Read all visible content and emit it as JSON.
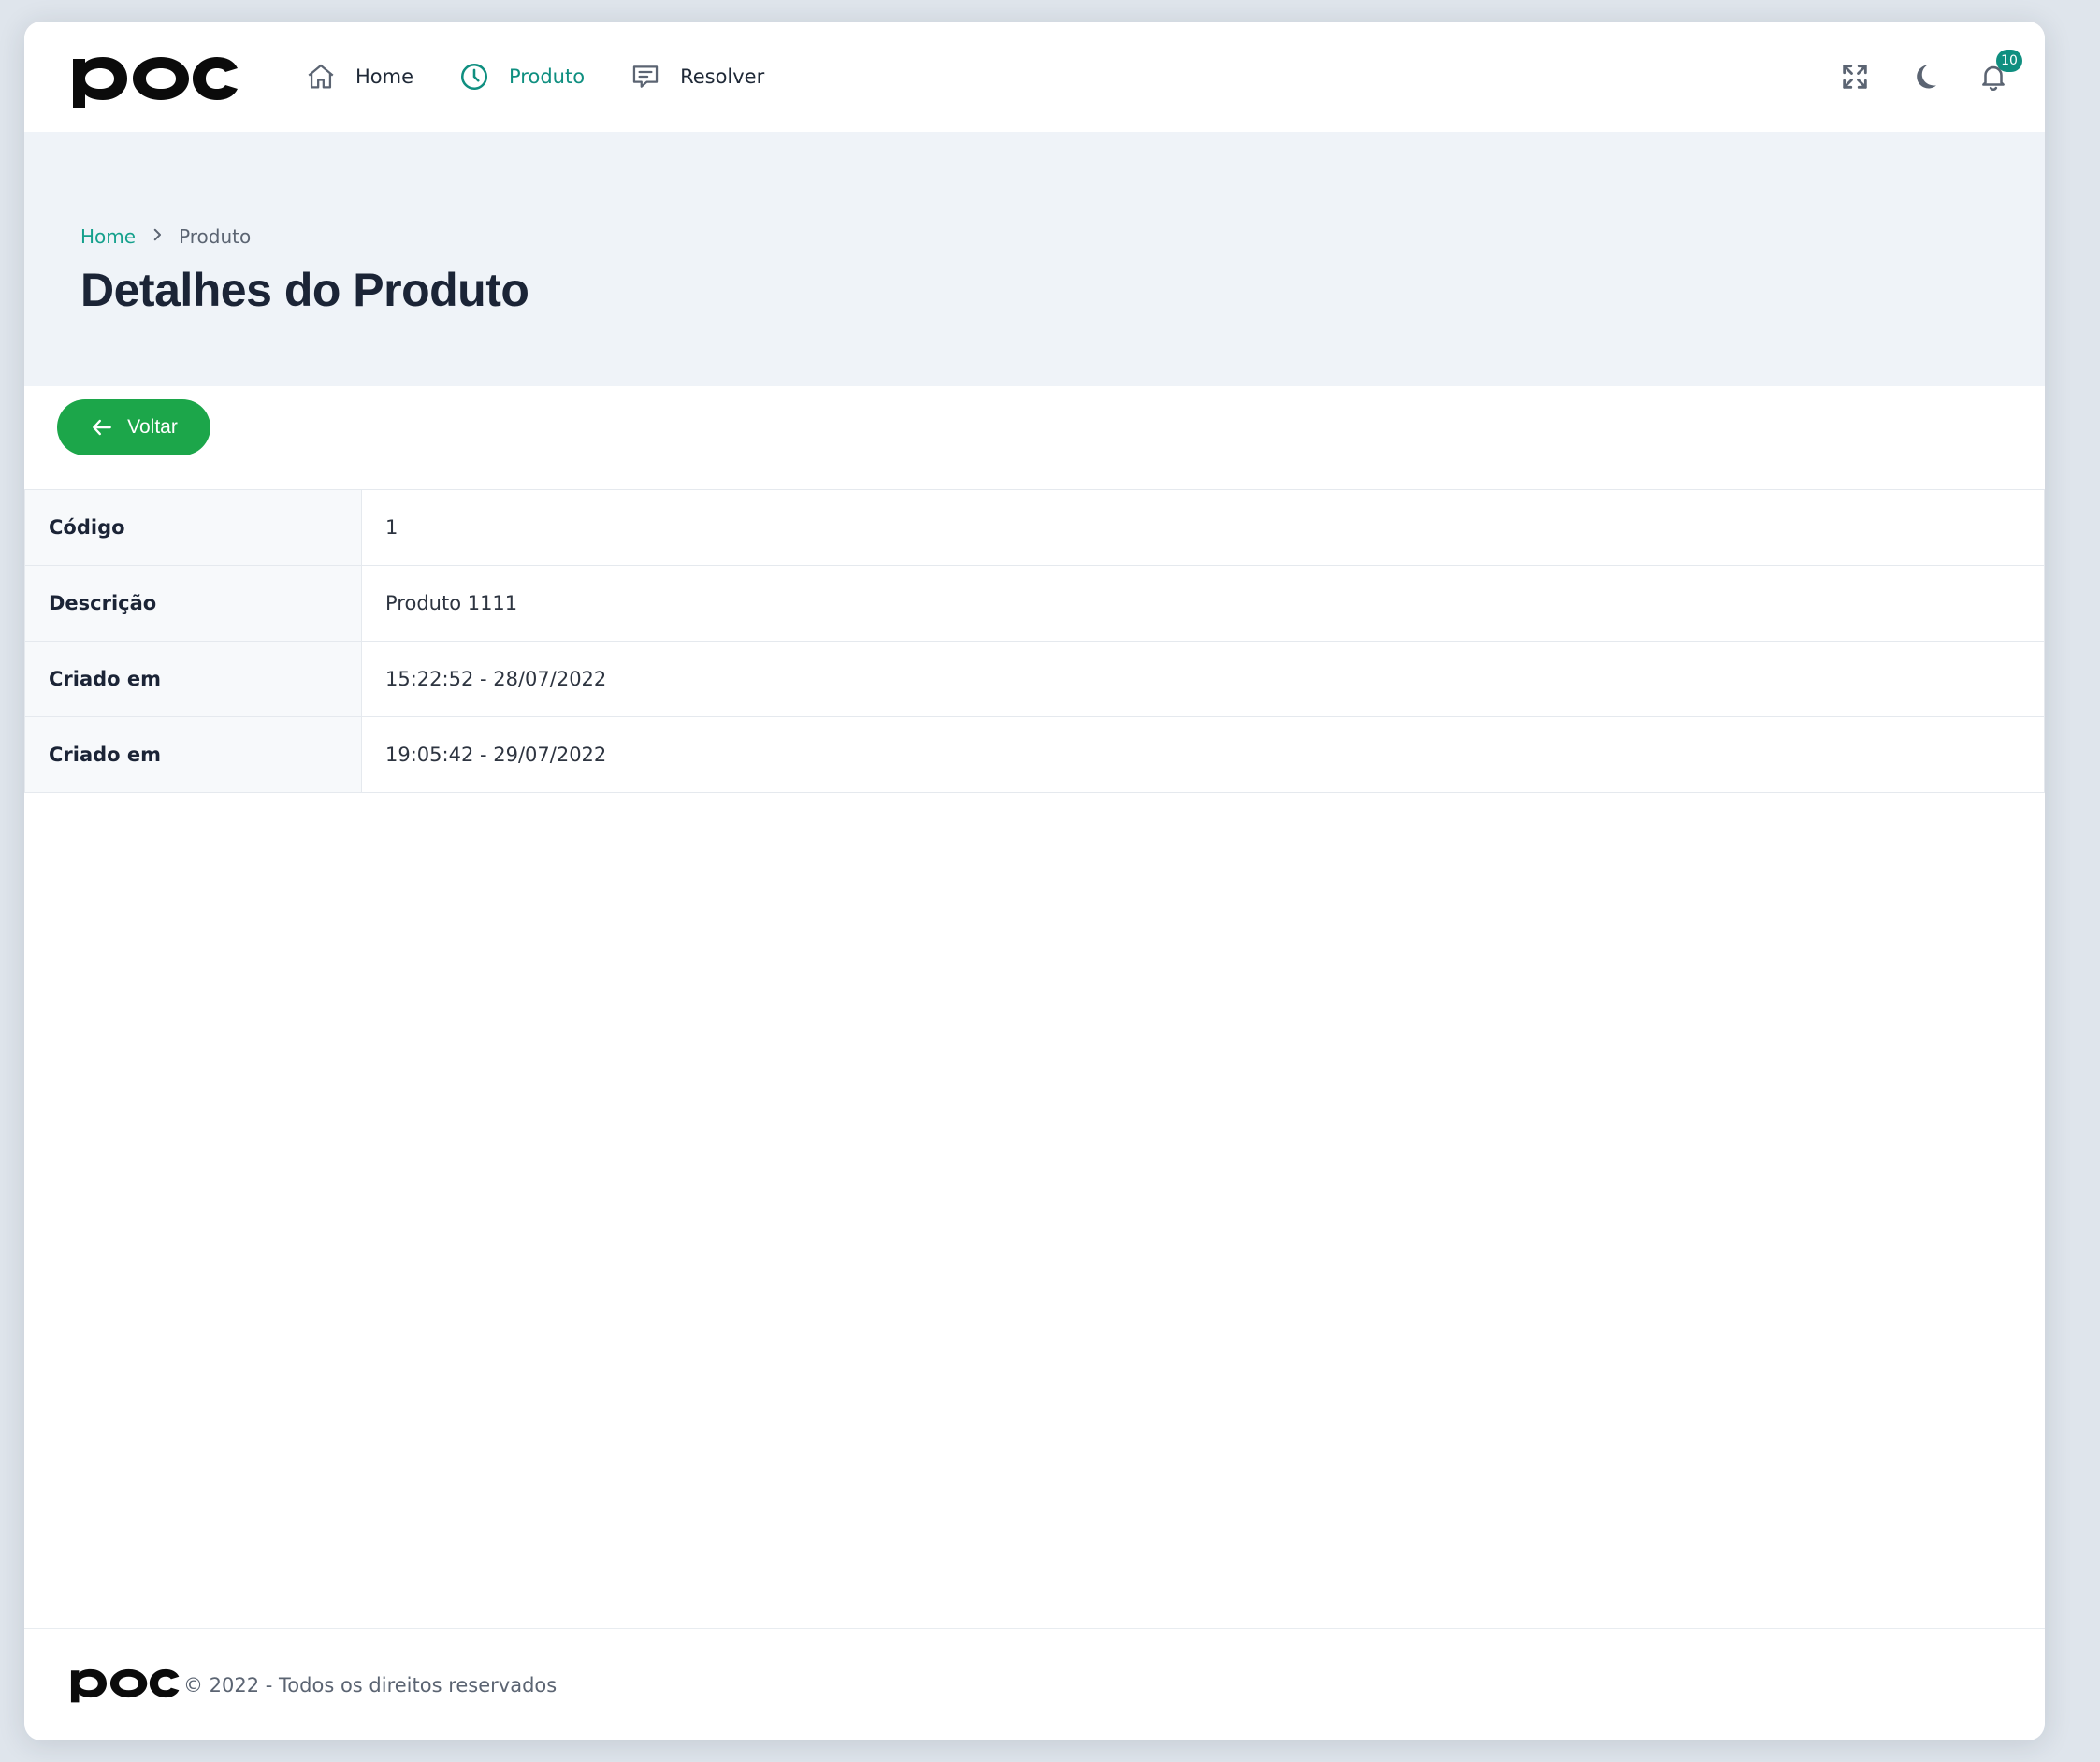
{
  "brand": {
    "logo": "poc",
    "accent": "#0f8f80",
    "link": "#14a08c",
    "button": "#1ca64a"
  },
  "nav": {
    "items": [
      {
        "label": "Home",
        "icon": "home-icon",
        "active": false
      },
      {
        "label": "Produto",
        "icon": "clock-icon",
        "active": true
      },
      {
        "label": "Resolver",
        "icon": "message-icon",
        "active": false
      }
    ]
  },
  "top_actions": {
    "fullscreen_icon": "fullscreen-icon",
    "theme_icon": "moon-icon",
    "notifications_icon": "bell-icon",
    "notification_count": "10"
  },
  "breadcrumb": {
    "home": "Home",
    "current": "Produto"
  },
  "page": {
    "title": "Detalhes do Produto"
  },
  "actions": {
    "back_label": "Voltar"
  },
  "details": {
    "rows": [
      {
        "label": "Código",
        "value": "1"
      },
      {
        "label": "Descrição",
        "value": "Produto 1111"
      },
      {
        "label": "Criado em",
        "value": "15:22:52 - 28/07/2022"
      },
      {
        "label": "Criado em",
        "value": "19:05:42 - 29/07/2022"
      }
    ]
  },
  "footer": {
    "text": "© 2022 - Todos os direitos reservados"
  }
}
